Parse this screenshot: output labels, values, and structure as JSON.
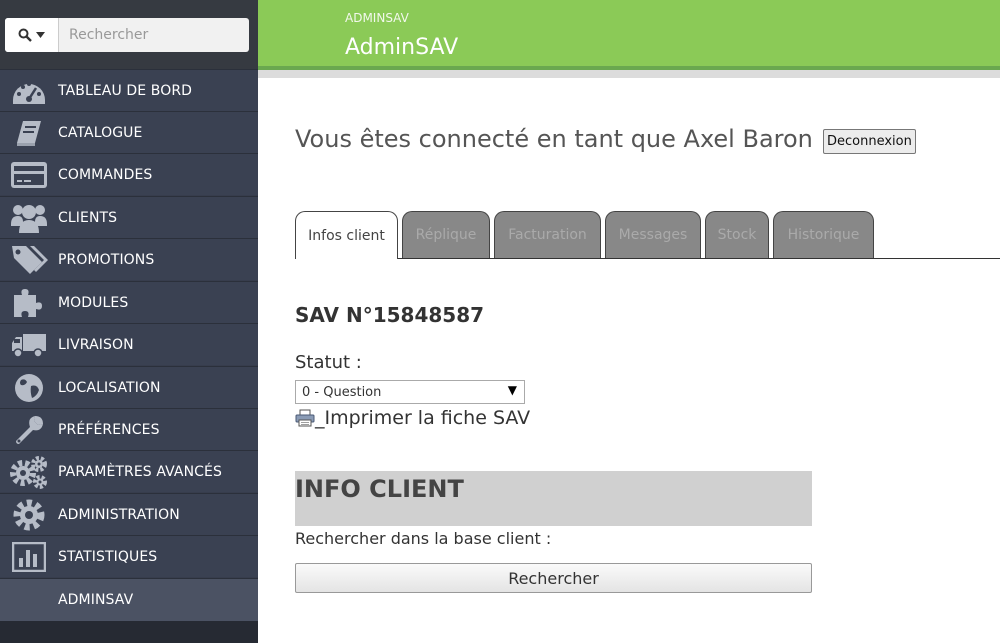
{
  "sidebar": {
    "search": {
      "placeholder": "Rechercher",
      "icon": "search-icon"
    },
    "items": [
      {
        "label": "TABLEAU DE BORD",
        "icon": "dashboard-icon"
      },
      {
        "label": "CATALOGUE",
        "icon": "book-icon"
      },
      {
        "label": "COMMANDES",
        "icon": "credit-card-icon"
      },
      {
        "label": "CLIENTS",
        "icon": "users-icon"
      },
      {
        "label": "PROMOTIONS",
        "icon": "tags-icon"
      },
      {
        "label": "MODULES",
        "icon": "puzzle-icon"
      },
      {
        "label": "LIVRAISON",
        "icon": "truck-icon"
      },
      {
        "label": "LOCALISATION",
        "icon": "globe-icon"
      },
      {
        "label": "PRÉFÉRENCES",
        "icon": "wrench-icon"
      },
      {
        "label": "PARAMÈTRES AVANCÉS",
        "icon": "cogs-icon"
      },
      {
        "label": "ADMINISTRATION",
        "icon": "gear-icon"
      },
      {
        "label": "STATISTIQUES",
        "icon": "bar-chart-icon"
      },
      {
        "label": "ADMINSAV",
        "icon": "",
        "active": true
      }
    ]
  },
  "header": {
    "subtitle": "ADMINSAV",
    "title": "AdminSAV",
    "color": "#8bca57"
  },
  "main": {
    "welcome": "Vous êtes connecté en tant que Axel Baron",
    "logout_label": "Deconnexion",
    "tabs": [
      {
        "label": "Infos client",
        "active": true
      },
      {
        "label": "Réplique"
      },
      {
        "label": "Facturation"
      },
      {
        "label": "Messages"
      },
      {
        "label": "Stock"
      },
      {
        "label": "Historique"
      }
    ],
    "sav_number": "SAV N°15848587",
    "status_label": "Statut :",
    "status_value": "0 - Question",
    "print_label": "Imprimer la fiche SAV",
    "info_client_title": "INFO CLIENT",
    "search_db_label": "Rechercher dans la base client :",
    "search_button_label": "Rechercher"
  }
}
